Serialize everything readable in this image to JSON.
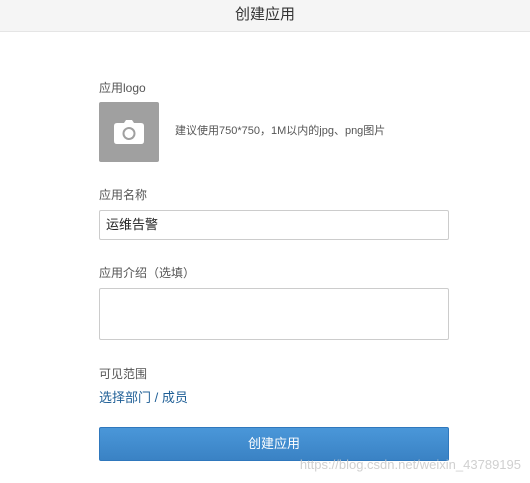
{
  "header": {
    "title": "创建应用"
  },
  "form": {
    "logo": {
      "label": "应用logo",
      "icon": "camera-icon",
      "hint": "建议使用750*750，1M以内的jpg、png图片"
    },
    "name": {
      "label": "应用名称",
      "value": "运维告警"
    },
    "description": {
      "label": "应用介绍（选填）",
      "value": ""
    },
    "visibility": {
      "label": "可见范围",
      "link": "选择部门 / 成员"
    },
    "submit_label": "创建应用"
  },
  "watermark": "https://blog.csdn.net/weixin_43789195",
  "colors": {
    "button": "#3a87c8",
    "link": "#1f5f96",
    "logo_box": "#a0a0a0"
  }
}
